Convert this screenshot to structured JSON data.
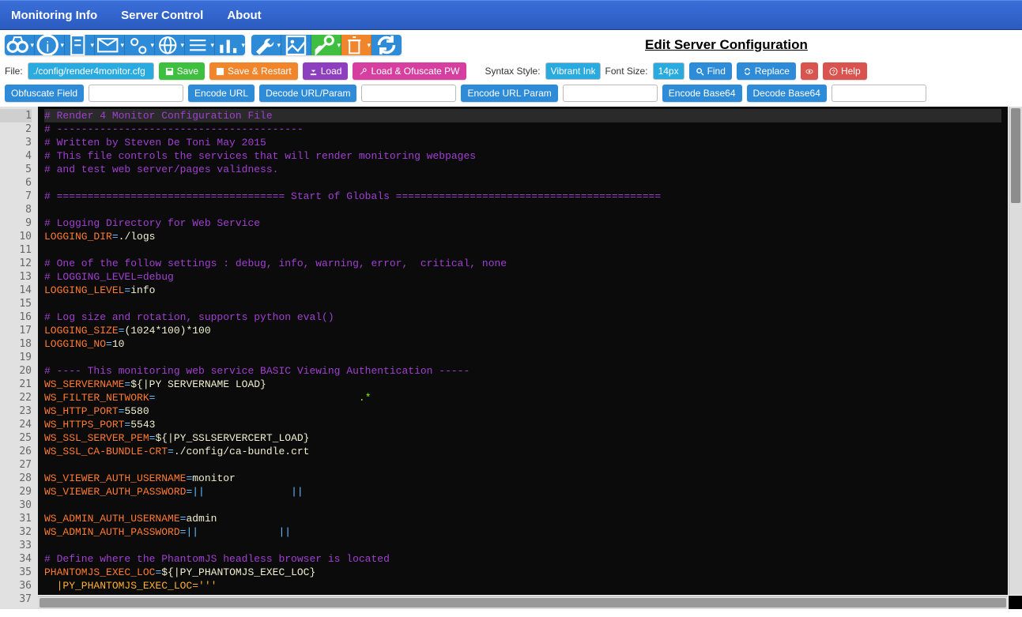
{
  "nav": {
    "monitoring": "Monitoring Info",
    "server": "Server Control",
    "about": "About"
  },
  "title": "Edit Server Configuration",
  "file_label": "File:",
  "file_value": "./config/render4monitor.cfg",
  "buttons": {
    "save": "Save",
    "save_restart": "Save & Restart",
    "load": "Load",
    "load_ofuscate": "Load & Ofuscate PW"
  },
  "syntax_label": "Syntax Style:",
  "syntax_value": "Vibrant Ink",
  "fontsize_label": "Font Size:",
  "fontsize_value": "14px",
  "find": "Find",
  "replace": "Replace",
  "help": "Help",
  "encode_bar": {
    "obfuscate": "Obfuscate Field",
    "encode_url": "Encode URL",
    "decode_url": "Decode URL/Param",
    "encode_url_param": "Encode URL Param",
    "encode_b64": "Encode Base64",
    "decode_b64": "Decode Base64"
  },
  "code_lines": [
    {
      "n": 1,
      "t": "comment",
      "text": "# Render 4 Monitor Configuration File",
      "hi": true
    },
    {
      "n": 2,
      "t": "comment",
      "text": "# ----------------------------------------"
    },
    {
      "n": 3,
      "t": "comment",
      "text": "# Written by Steven De Toni May 2015"
    },
    {
      "n": 4,
      "t": "comment",
      "text": "# This file controls the services that will render monitoring webpages"
    },
    {
      "n": 5,
      "t": "comment",
      "text": "# and test web server/pages validness."
    },
    {
      "n": 6,
      "t": "blank",
      "text": ""
    },
    {
      "n": 7,
      "t": "comment",
      "text": "# ===================================== Start of Globals ==========================================="
    },
    {
      "n": 8,
      "t": "blank",
      "text": ""
    },
    {
      "n": 9,
      "t": "comment",
      "text": "# Logging Directory for Web Service"
    },
    {
      "n": 10,
      "t": "kv",
      "key": "LOGGING_DIR",
      "val": "./logs"
    },
    {
      "n": 11,
      "t": "blank",
      "text": ""
    },
    {
      "n": 12,
      "t": "comment",
      "text": "# One of the follow settings : debug, info, warning, error,  critical, none"
    },
    {
      "n": 13,
      "t": "comment",
      "text": "# LOGGING_LEVEL=debug"
    },
    {
      "n": 14,
      "t": "kv",
      "key": "LOGGING_LEVEL",
      "val": "info"
    },
    {
      "n": 15,
      "t": "blank",
      "text": ""
    },
    {
      "n": 16,
      "t": "comment",
      "text": "# Log size and rotation, supports python eval()"
    },
    {
      "n": 17,
      "t": "kv",
      "key": "LOGGING_SIZE",
      "val": "(1024*100)*100"
    },
    {
      "n": 18,
      "t": "kv",
      "key": "LOGGING_NO",
      "val": "10"
    },
    {
      "n": 19,
      "t": "blank",
      "text": ""
    },
    {
      "n": 20,
      "t": "comment",
      "text": "# ---- This monitoring web service BASIC Viewing Authentication -----"
    },
    {
      "n": 21,
      "t": "kv",
      "key": "WS_SERVERNAME",
      "val": "${|PY SERVERNAME LOAD}"
    },
    {
      "n": 22,
      "t": "kv2",
      "key": "WS_FILTER_NETWORK",
      "pre": "=",
      "mid": "",
      "suf": ".*"
    },
    {
      "n": 23,
      "t": "kv",
      "key": "WS_HTTP_PORT",
      "val": "5580"
    },
    {
      "n": 24,
      "t": "kv",
      "key": "WS_HTTPS_PORT",
      "val": "5543"
    },
    {
      "n": 25,
      "t": "kv",
      "key": "WS_SSL_SERVER_PEM",
      "val": "${|PY_SSLSERVERCERT_LOAD}"
    },
    {
      "n": 26,
      "t": "kv",
      "key": "WS_SSL_CA-BUNDLE-CRT",
      "val": "./config/ca-bundle.crt"
    },
    {
      "n": 27,
      "t": "blank",
      "text": ""
    },
    {
      "n": 28,
      "t": "kv",
      "key": "WS_VIEWER_AUTH_USERNAME",
      "val": "monitor"
    },
    {
      "n": 29,
      "t": "kvpipe",
      "key": "WS_VIEWER_AUTH_PASSWORD",
      "pre": "||",
      "mid": "              ",
      "suf": "||"
    },
    {
      "n": 30,
      "t": "blank",
      "text": ""
    },
    {
      "n": 31,
      "t": "kv",
      "key": "WS_ADMIN_AUTH_USERNAME",
      "val": "admin"
    },
    {
      "n": 32,
      "t": "kvpipe",
      "key": "WS_ADMIN_AUTH_PASSWORD",
      "pre": "||",
      "mid": "             ",
      "suf": "||"
    },
    {
      "n": 33,
      "t": "blank",
      "text": ""
    },
    {
      "n": 34,
      "t": "comment",
      "text": "# Define where the PhantomJS headless browser is located"
    },
    {
      "n": 35,
      "t": "kv",
      "key": "PHANTOMJS_EXEC_LOC",
      "val": "${|PY_PHANTOMJS_EXEC_LOC}"
    },
    {
      "n": 36,
      "t": "raw",
      "text": "  |PY_PHANTOMJS_EXEC_LOC='''"
    },
    {
      "n": 37,
      "t": "blank",
      "text": ""
    }
  ]
}
